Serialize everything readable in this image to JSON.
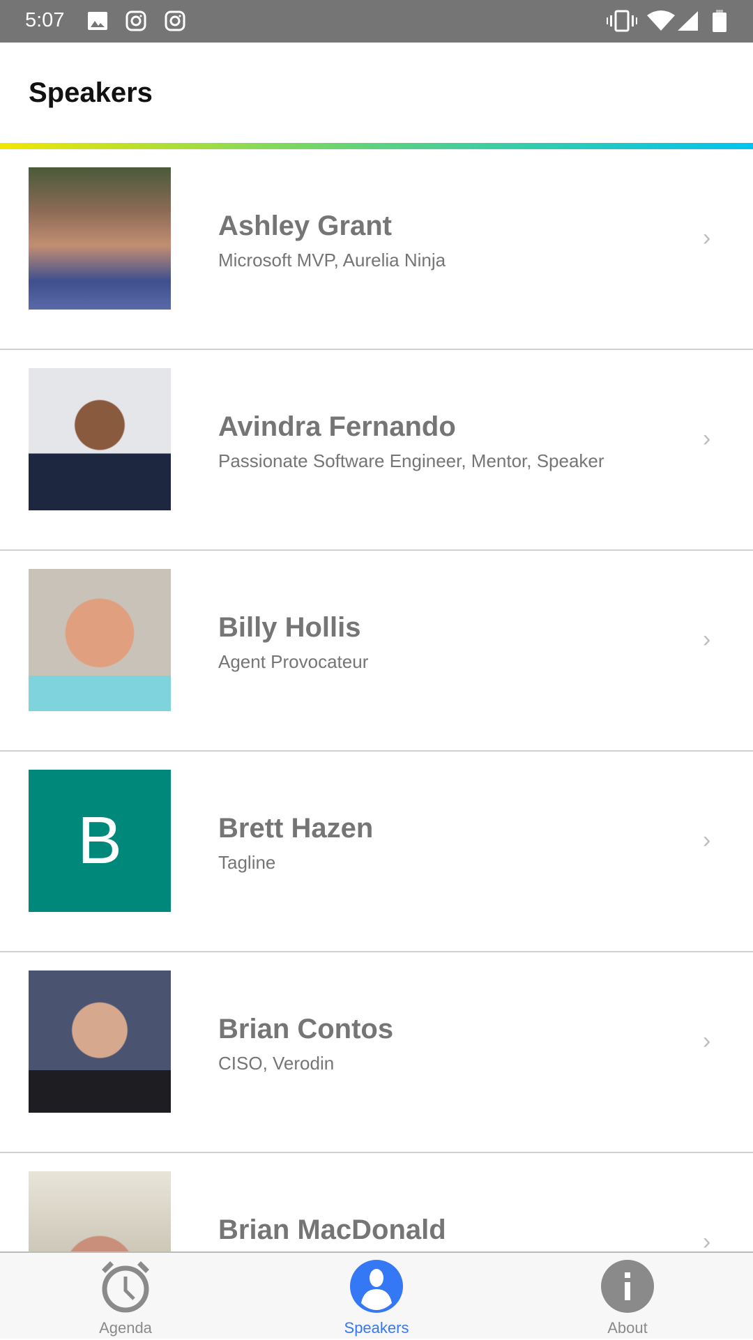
{
  "status_bar": {
    "time": "5:07"
  },
  "header": {
    "title": "Speakers"
  },
  "speakers": [
    {
      "name": "Ashley Grant",
      "tagline": "Microsoft MVP, Aurelia Ninja",
      "photo": "photo"
    },
    {
      "name": "Avindra Fernando",
      "tagline": "Passionate Software Engineer, Mentor, Speaker",
      "photo": "photo"
    },
    {
      "name": "Billy Hollis",
      "tagline": "Agent Provocateur",
      "photo": "photo"
    },
    {
      "name": "Brett Hazen",
      "tagline": "Tagline",
      "photo": "letter",
      "letter": "B",
      "color": "#00897b"
    },
    {
      "name": "Brian Contos",
      "tagline": "CISO, Verodin",
      "photo": "photo"
    },
    {
      "name": "Brian MacDonald",
      "tagline": "",
      "photo": "photo"
    }
  ],
  "nav": {
    "tabs": [
      {
        "label": "Agenda",
        "icon": "alarm-clock-icon"
      },
      {
        "label": "Speakers",
        "icon": "person-icon",
        "active": true
      },
      {
        "label": "About",
        "icon": "info-icon"
      }
    ],
    "active_color": "#3478f6"
  }
}
